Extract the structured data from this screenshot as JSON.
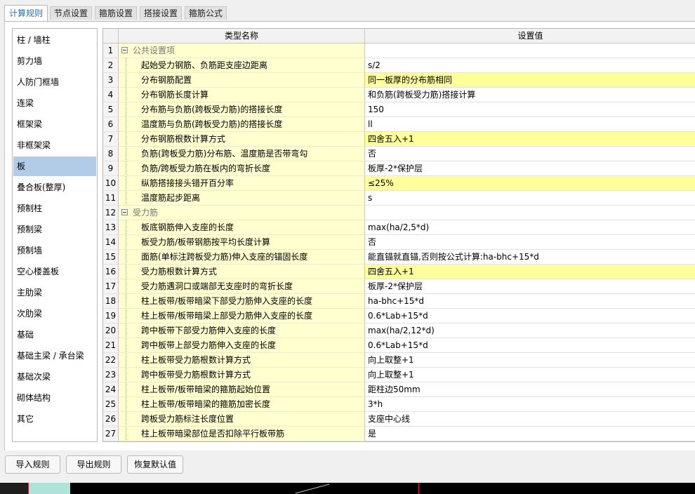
{
  "tabs": [
    "计算规则",
    "节点设置",
    "箍筋设置",
    "搭接设置",
    "箍筋公式"
  ],
  "sidebar": {
    "items": [
      "柱 / 墙柱",
      "剪力墙",
      "人防门框墙",
      "连梁",
      "框架梁",
      "非框架梁",
      "板",
      "叠合板(整厚)",
      "预制柱",
      "预制梁",
      "预制墙",
      "空心楼盖板",
      "主肋梁",
      "次肋梁",
      "基础",
      "基础主梁 / 承台梁",
      "基础次梁",
      "砌体结构",
      "其它"
    ],
    "selected": 6
  },
  "grid": {
    "col_name": "类型名称",
    "col_value": "设置值",
    "rows": [
      {
        "num": "1",
        "name": "公共设置项",
        "value": "",
        "group": true
      },
      {
        "num": "2",
        "name": "起始受力钢筋、负筋距支座边距离",
        "value": "s/2"
      },
      {
        "num": "3",
        "name": "分布钢筋配置",
        "value": "同一板厚的分布筋相同",
        "highlight": true
      },
      {
        "num": "4",
        "name": "分布钢筋长度计算",
        "value": "和负筋(跨板受力筋)搭接计算"
      },
      {
        "num": "5",
        "name": "分布筋与负筋(跨板受力筋)的搭接长度",
        "value": "150"
      },
      {
        "num": "6",
        "name": "温度筋与负筋(跨板受力筋)的搭接长度",
        "value": "ll"
      },
      {
        "num": "7",
        "name": "分布钢筋根数计算方式",
        "value": "四舍五入+1",
        "highlight": true
      },
      {
        "num": "8",
        "name": "负筋(跨板受力筋)分布筋、温度筋是否带弯勾",
        "value": "否"
      },
      {
        "num": "9",
        "name": "负筋/跨板受力筋在板内的弯折长度",
        "value": "板厚-2*保护层"
      },
      {
        "num": "10",
        "name": "纵筋搭接接头错开百分率",
        "value": "≤25%",
        "highlight": true
      },
      {
        "num": "11",
        "name": "温度筋起步距离",
        "value": "s"
      },
      {
        "num": "12",
        "name": "受力筋",
        "value": "",
        "group": true
      },
      {
        "num": "13",
        "name": "板底钢筋伸入支座的长度",
        "value": "max(ha/2,5*d)"
      },
      {
        "num": "14",
        "name": "板受力筋/板带钢筋按平均长度计算",
        "value": "否"
      },
      {
        "num": "15",
        "name": "面筋(单标注跨板受力筋)伸入支座的锚固长度",
        "value": "能直锚就直锚,否则按公式计算:ha-bhc+15*d"
      },
      {
        "num": "16",
        "name": "受力筋根数计算方式",
        "value": "四舍五入+1",
        "highlight": true
      },
      {
        "num": "17",
        "name": "受力筋遇洞口或端部无支座时的弯折长度",
        "value": "板厚-2*保护层"
      },
      {
        "num": "18",
        "name": "柱上板带/板带暗梁下部受力筋伸入支座的长度",
        "value": "ha-bhc+15*d"
      },
      {
        "num": "19",
        "name": "柱上板带/板带暗梁上部受力筋伸入支座的长度",
        "value": "0.6*Lab+15*d"
      },
      {
        "num": "20",
        "name": "跨中板带下部受力筋伸入支座的长度",
        "value": "max(ha/2,12*d)"
      },
      {
        "num": "21",
        "name": "跨中板带上部受力筋伸入支座的长度",
        "value": "0.6*Lab+15*d"
      },
      {
        "num": "22",
        "name": "柱上板带受力筋根数计算方式",
        "value": "向上取整+1"
      },
      {
        "num": "23",
        "name": "跨中板带受力筋根数计算方式",
        "value": "向上取整+1"
      },
      {
        "num": "24",
        "name": "柱上板带/板带暗梁的箍筋起始位置",
        "value": "距柱边50mm"
      },
      {
        "num": "25",
        "name": "柱上板带/板带暗梁的箍筋加密长度",
        "value": "3*h"
      },
      {
        "num": "26",
        "name": "跨板受力筋标注长度位置",
        "value": "支座中心线"
      },
      {
        "num": "27",
        "name": "柱上板带暗梁部位是否扣除平行板带筋",
        "value": "是"
      }
    ]
  },
  "buttons": {
    "import": "导入规则",
    "export": "导出规则",
    "restore": "恢复默认值"
  },
  "colors": {
    "accent": "#1e73be",
    "name_cell": "#ffffd0",
    "value_highlight": "#ffff9c",
    "sidebar_selected": "#b2cbe7"
  }
}
